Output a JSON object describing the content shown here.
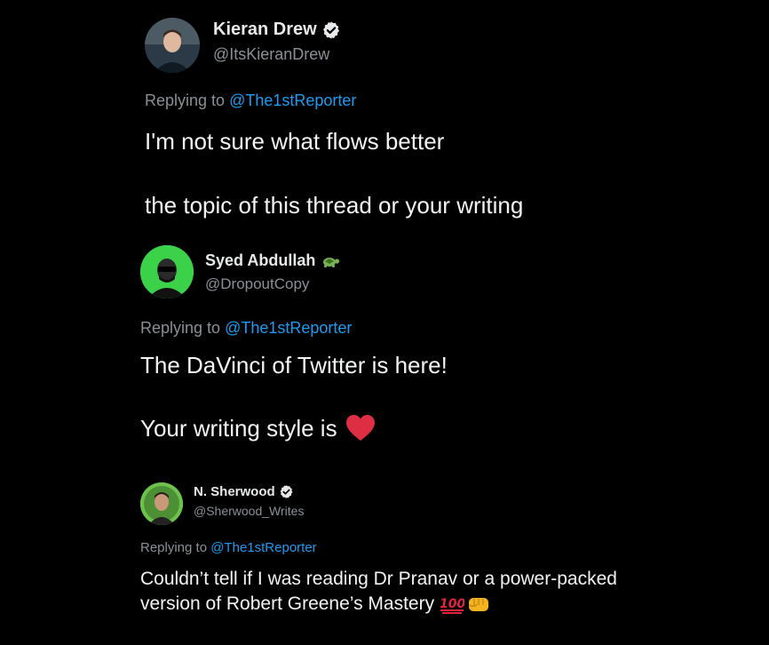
{
  "tweets": [
    {
      "name": "Kieran Drew",
      "handle": "@ItsKieranDrew",
      "verified": true,
      "reply_prefix": "Replying to ",
      "reply_to": "@The1stReporter",
      "lines": [
        "I'm not sure what flows better",
        "the topic of this thread or your writing"
      ]
    },
    {
      "name": "Syed Abdullah",
      "handle": "@DropoutCopy",
      "name_emoji": "turtle",
      "reply_prefix": "Replying to ",
      "reply_to": "@The1stReporter",
      "lines": [
        "The DaVinci of Twitter is here!",
        "Your writing style is"
      ],
      "line_emoji": "red-heart"
    },
    {
      "name": "N. Sherwood",
      "handle": "@Sherwood_Writes",
      "verified": true,
      "reply_prefix": "Replying to ",
      "reply_to": "@The1stReporter",
      "lines": [
        "Couldn’t tell if I was reading Dr Pranav or a power-packed",
        "version of Robert Greene’s Mastery"
      ],
      "line_emojis": [
        "hundred-points",
        "fist"
      ]
    }
  ],
  "colors": {
    "background": "#000000",
    "text": "#e7e9ea",
    "muted": "#8b9096",
    "link": "#1d9bf0"
  }
}
